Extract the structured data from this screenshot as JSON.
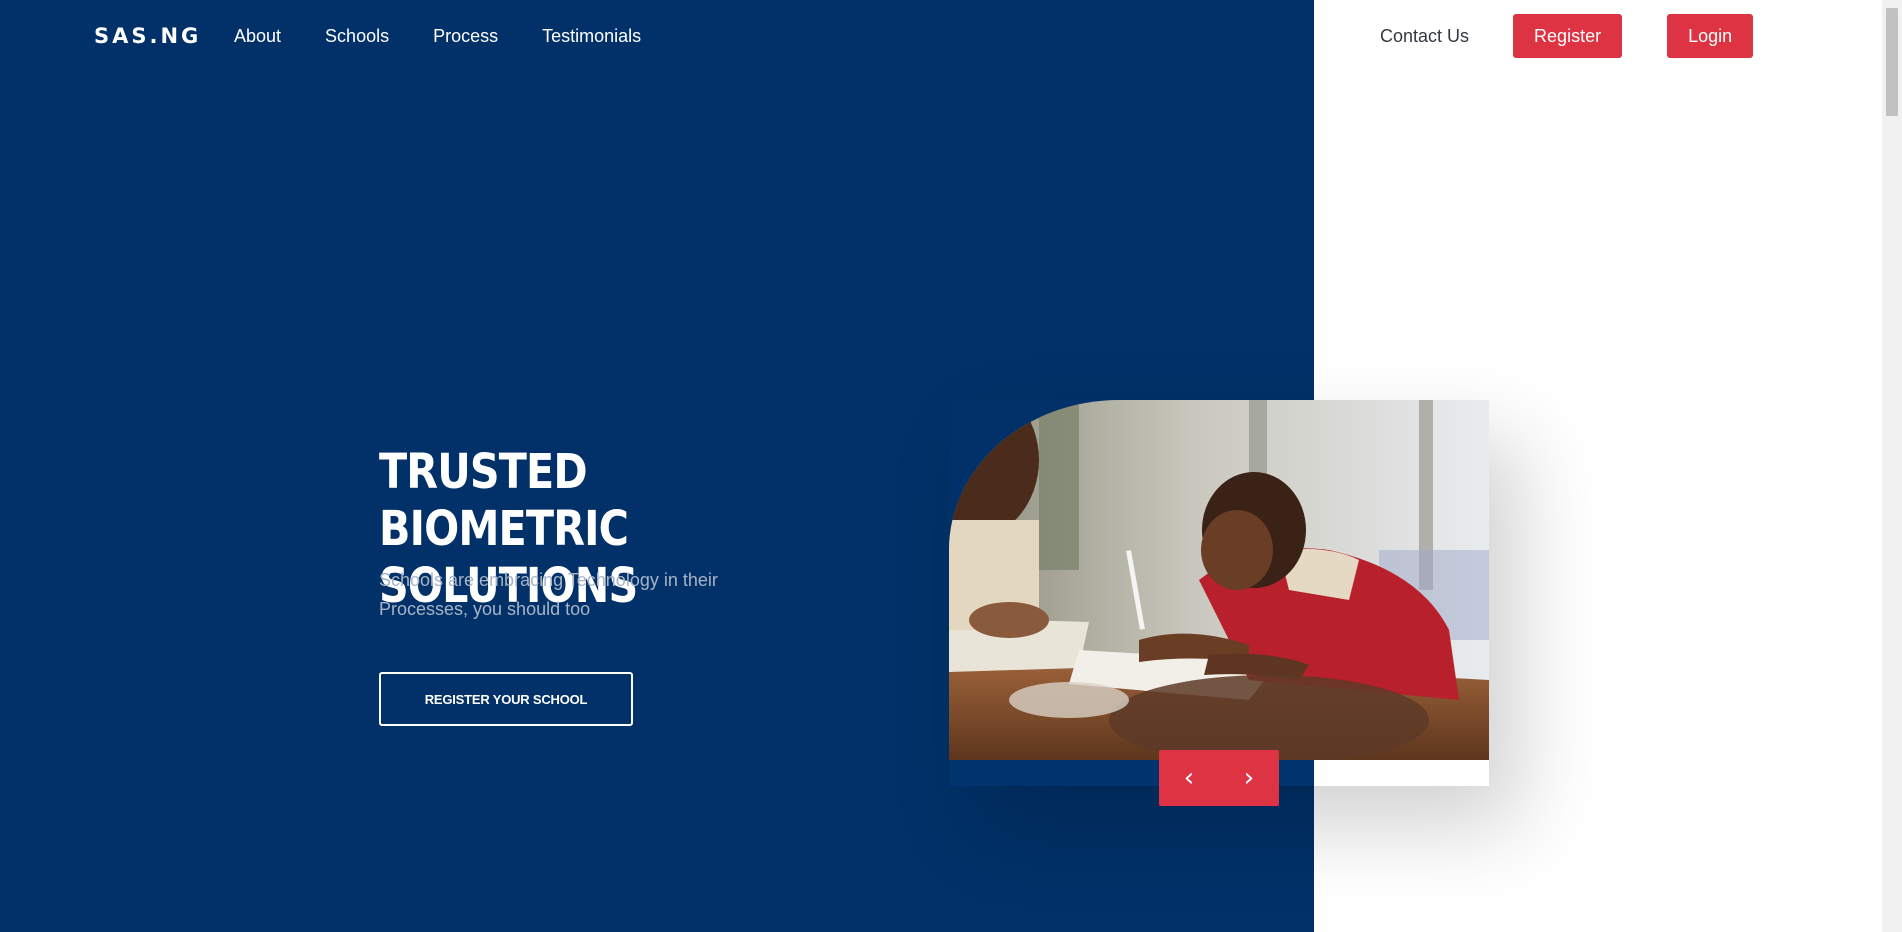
{
  "header": {
    "logo": "SAS.NG",
    "nav": [
      "About",
      "Schools",
      "Process",
      "Testimonials"
    ],
    "contact_label": "Contact Us",
    "register_label": "Register",
    "login_label": "Login"
  },
  "hero": {
    "title": "TRUSTED BIOMETRIC SOLUTIONS",
    "subtitle": "Schools are embracing Technology in their Processes, you should too",
    "cta_label": "REGISTER YOUR SCHOOL"
  },
  "carousel": {
    "image_alt": "students-writing-photo",
    "prev_icon": "chevron-left-icon",
    "next_icon": "chevron-right-icon"
  },
  "colors": {
    "primary": "#013168",
    "accent": "#dd3343",
    "subtitle_text": "#a7b4c6"
  }
}
